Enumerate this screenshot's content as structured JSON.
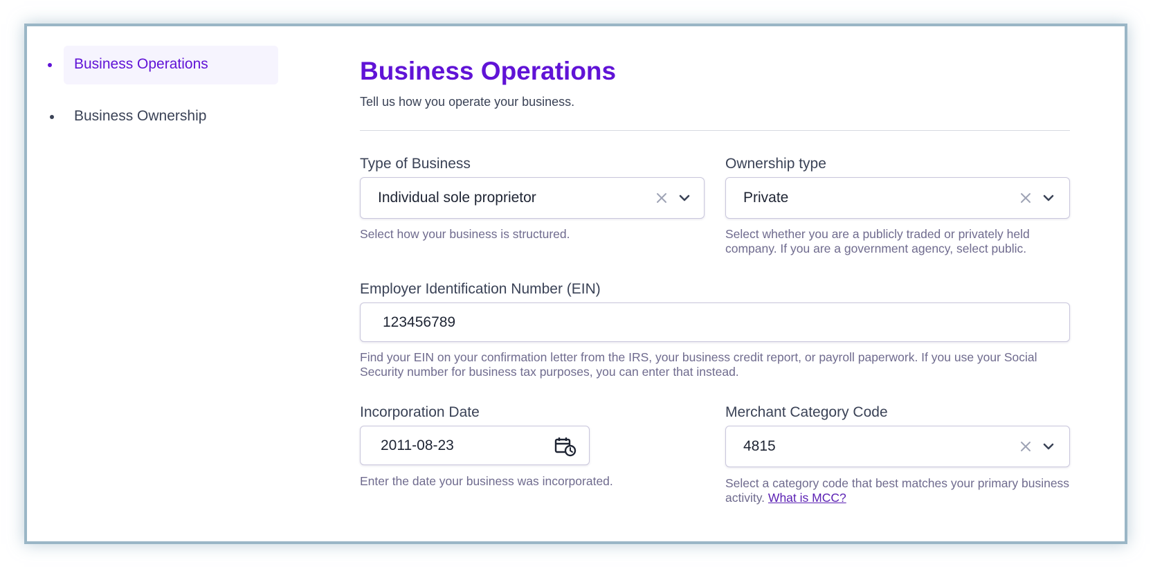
{
  "sidebar": {
    "items": [
      {
        "label": "Business Operations",
        "active": true
      },
      {
        "label": "Business Ownership",
        "active": false
      }
    ]
  },
  "page": {
    "title": "Business Operations",
    "subtitle": "Tell us how you operate your business."
  },
  "fields": {
    "type_of_business": {
      "label": "Type of Business",
      "value": "Individual sole proprietor",
      "help": "Select how your business is structured."
    },
    "ownership_type": {
      "label": "Ownership type",
      "value": "Private",
      "help": "Select whether you are a publicly traded or privately held company. If you are a government agency, select public."
    },
    "ein": {
      "label": "Employer Identification Number (EIN)",
      "value": "123456789",
      "help": "Find your EIN on your confirmation letter from the IRS, your business credit report, or payroll paperwork. If you use your Social Security number for business tax purposes, you can enter that instead."
    },
    "incorporation_date": {
      "label": "Incorporation Date",
      "value": "2011-08-23",
      "help": "Enter the date your business was incorporated."
    },
    "mcc": {
      "label": "Merchant Category Code",
      "value": "4815",
      "help": "Select a category code that best matches your primary business activity.",
      "help_link": "What is MCC?"
    }
  },
  "icons": {
    "clear": "close-icon",
    "dropdown": "chevron-down-icon",
    "calendar": "calendar-clock-icon"
  },
  "colors": {
    "accent": "#6013d6",
    "frame_border": "#9ab6c6",
    "active_nav_bg": "#f6f4fe"
  }
}
